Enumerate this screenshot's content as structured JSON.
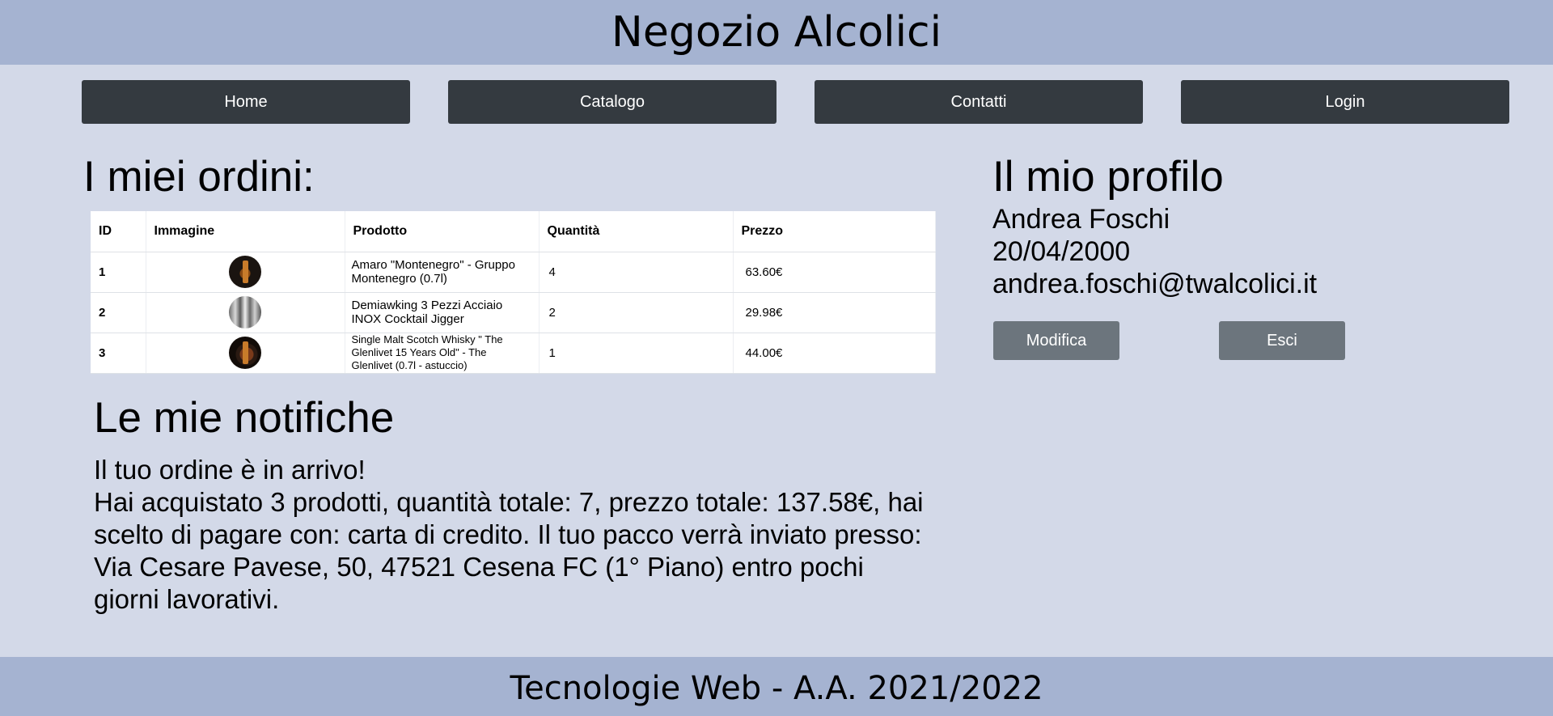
{
  "header": {
    "title": "Negozio Alcolici"
  },
  "nav": {
    "items": [
      {
        "label": "Home"
      },
      {
        "label": "Catalogo"
      },
      {
        "label": "Contatti"
      },
      {
        "label": "Login"
      }
    ]
  },
  "orders": {
    "title": "I miei ordini:",
    "columns": [
      "ID",
      "Immagine",
      "Prodotto",
      "Quantità",
      "Prezzo"
    ],
    "rows": [
      {
        "id": "1",
        "image": "amaro-bottle-thumbnail",
        "product": "Amaro \"Montenegro\" - Gruppo Montenegro (0.7l)",
        "quantity": "4",
        "price": "63.60€"
      },
      {
        "id": "2",
        "image": "cocktail-jigger-thumbnail",
        "product": "Demiawking 3 Pezzi Acciaio INOX Cocktail Jigger",
        "quantity": "2",
        "price": "29.98€"
      },
      {
        "id": "3",
        "image": "whisky-bottle-thumbnail",
        "product": "Single Malt Scotch Whisky \" The Glenlivet 15 Years Old\" - The Glenlivet (0.7l - astuccio)",
        "quantity": "1",
        "price": "44.00€"
      }
    ]
  },
  "profile": {
    "title": "Il mio profilo",
    "name": "Andrea Foschi",
    "birthdate": "20/04/2000",
    "email": "andrea.foschi@twalcolici.it",
    "edit_label": "Modifica",
    "logout_label": "Esci"
  },
  "notifications": {
    "title": "Le mie notifiche",
    "items": [
      {
        "headline": "Il tuo ordine è in arrivo!",
        "body": "Hai acquistato 3 prodotti, quantità totale: 7, prezzo totale: 137.58€, hai scelto di pagare con: carta di credito. Il tuo pacco verrà inviato presso: Via Cesare Pavese, 50, 47521 Cesena FC (1° Piano) entro pochi giorni lavorativi."
      }
    ]
  },
  "footer": {
    "text": "Tecnologie Web - A.A. 2021/2022"
  },
  "colors": {
    "page_background": "#d3d9e8",
    "header_background": "#a5b3d1",
    "nav_button": "#343a40",
    "profile_button": "#6c757d"
  }
}
